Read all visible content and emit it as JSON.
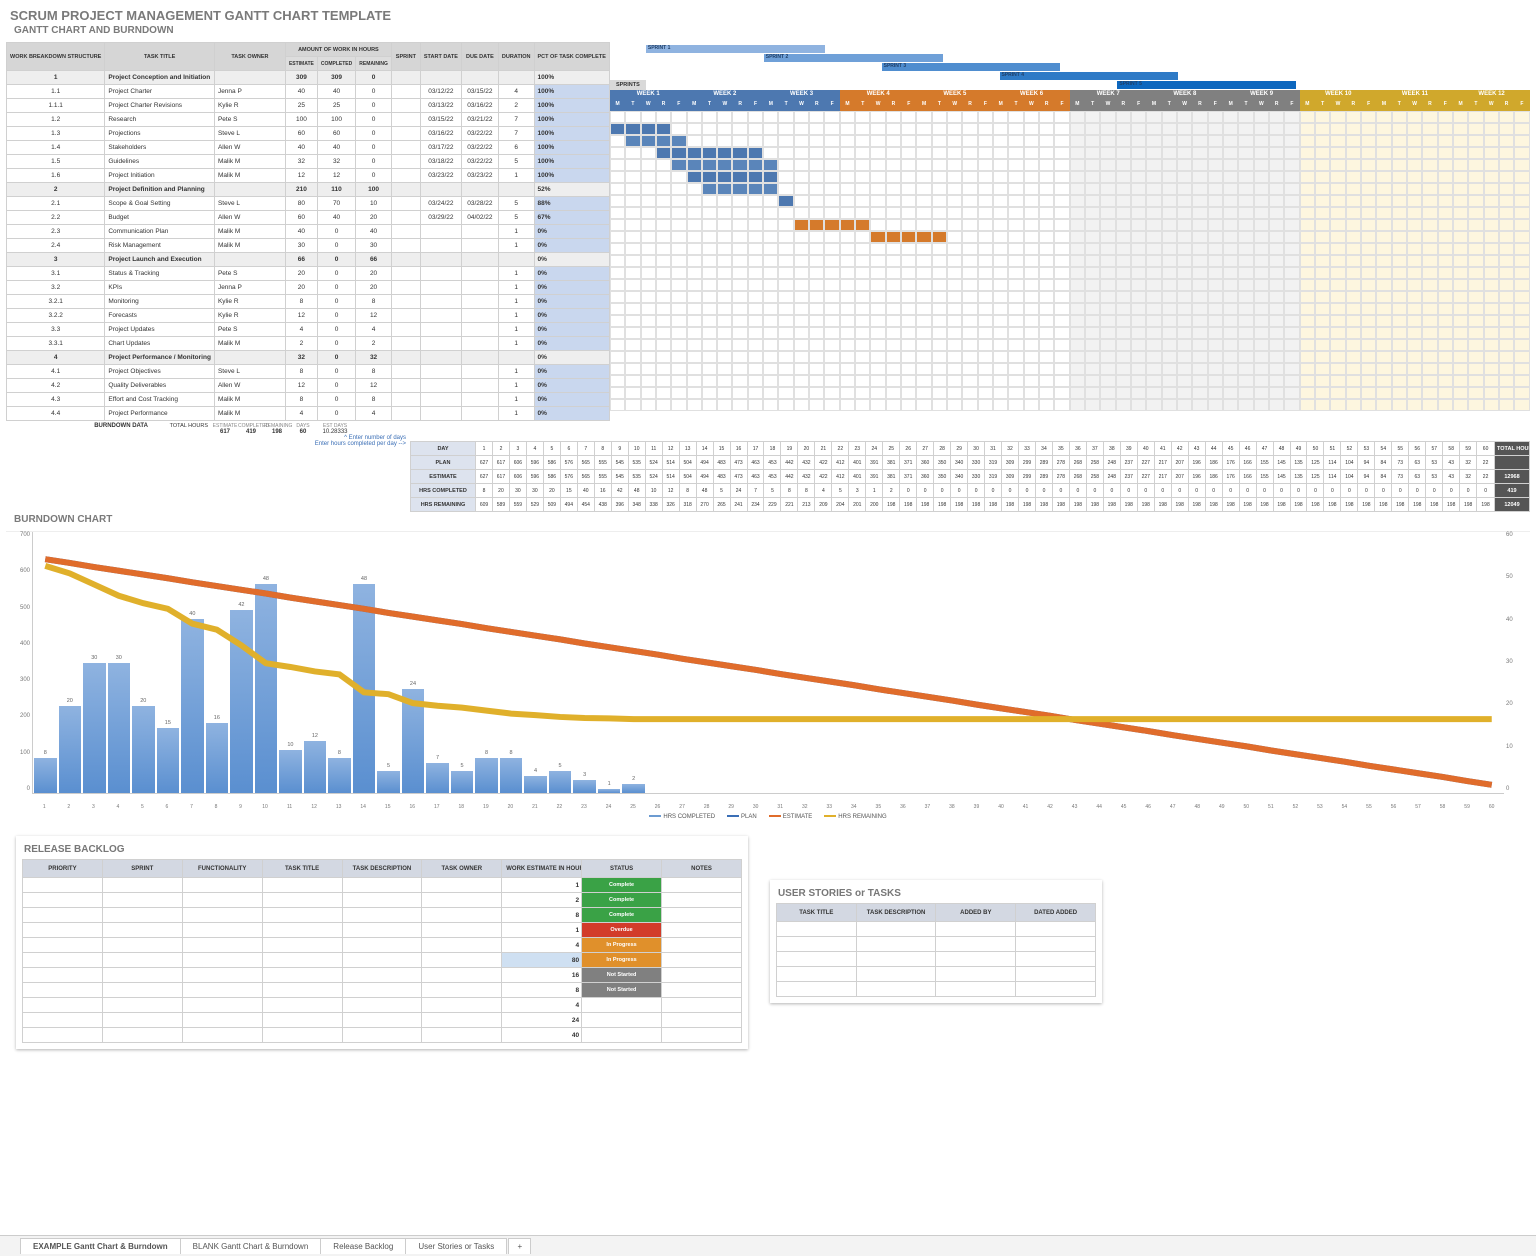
{
  "title": "SCRUM PROJECT MANAGEMENT GANTT CHART TEMPLATE",
  "subtitle": "GANTT CHART AND BURNDOWN",
  "burndown_chart_title": "BURNDOWN CHART",
  "burndown_data_title": "BURNDOWN DATA",
  "release_backlog_title": "RELEASE BACKLOG",
  "user_stories_title": "USER STORIES or TASKS",
  "task_headers": {
    "wbs": "WORK BREAKDOWN STRUCTURE",
    "title": "TASK TITLE",
    "owner": "TASK OWNER",
    "amount": "AMOUNT OF WORK IN HOURS",
    "est": "ESTIMATE",
    "comp": "COMPLETED",
    "rem": "REMAINING",
    "sprint": "SPRINT",
    "start": "START DATE",
    "due": "DUE DATE",
    "dur": "DURATION",
    "pct": "PCT OF TASK COMPLETE"
  },
  "sprints_label": "SPRINTS",
  "sprint_labels": [
    "SPRINT 1",
    "SPRINT 2",
    "SPRINT 3",
    "SPRINT 4",
    "SPRINT 5"
  ],
  "sprint_colors": [
    "#8fb3e0",
    "#6fa0d8",
    "#4f8dcf",
    "#2e7ac6",
    "#0d67be"
  ],
  "weeks": [
    {
      "label": "WEEK 1",
      "color": "#4d78b0"
    },
    {
      "label": "WEEK 2",
      "color": "#4d78b0"
    },
    {
      "label": "WEEK 3",
      "color": "#4d78b0"
    },
    {
      "label": "WEEK 4",
      "color": "#d57a2b"
    },
    {
      "label": "WEEK 5",
      "color": "#d57a2b"
    },
    {
      "label": "WEEK 6",
      "color": "#d57a2b"
    },
    {
      "label": "WEEK 7",
      "color": "#808080"
    },
    {
      "label": "WEEK 8",
      "color": "#808080"
    },
    {
      "label": "WEEK 9",
      "color": "#808080"
    },
    {
      "label": "WEEK 10",
      "color": "#d0a82c"
    },
    {
      "label": "WEEK 11",
      "color": "#d0a82c"
    },
    {
      "label": "WEEK 12",
      "color": "#d0a82c"
    }
  ],
  "days": [
    "M",
    "T",
    "W",
    "R",
    "F"
  ],
  "tasks": [
    {
      "wbs": "1",
      "title": "Project Conception and Initiation",
      "owner": "",
      "est": 309,
      "comp": 309,
      "rem": 0,
      "sprint": "",
      "start": "",
      "due": "",
      "dur": "",
      "pct": "100%",
      "sum": true
    },
    {
      "wbs": "1.1",
      "title": "Project Charter",
      "owner": "Jenna P",
      "est": 40,
      "comp": 40,
      "rem": 0,
      "sprint": "",
      "start": "03/12/22",
      "due": "03/15/22",
      "dur": 4,
      "pct": "100%",
      "bar": {
        "start": 0,
        "len": 4,
        "color": "#4d78b0"
      }
    },
    {
      "wbs": "1.1.1",
      "title": "Project Charter Revisions",
      "owner": "Kylie R",
      "est": 25,
      "comp": 25,
      "rem": 0,
      "sprint": "",
      "start": "03/13/22",
      "due": "03/16/22",
      "dur": 2,
      "pct": "100%",
      "bar": {
        "start": 1,
        "len": 4,
        "color": "#5a85ba"
      }
    },
    {
      "wbs": "1.2",
      "title": "Research",
      "owner": "Pete S",
      "est": 100,
      "comp": 100,
      "rem": 0,
      "sprint": "",
      "start": "03/15/22",
      "due": "03/21/22",
      "dur": 7,
      "pct": "100%",
      "bar": {
        "start": 3,
        "len": 7,
        "color": "#4d78b0"
      }
    },
    {
      "wbs": "1.3",
      "title": "Projections",
      "owner": "Steve L",
      "est": 60,
      "comp": 60,
      "rem": 0,
      "sprint": "",
      "start": "03/16/22",
      "due": "03/22/22",
      "dur": 7,
      "pct": "100%",
      "bar": {
        "start": 4,
        "len": 7,
        "color": "#5a85ba"
      }
    },
    {
      "wbs": "1.4",
      "title": "Stakeholders",
      "owner": "Allen W",
      "est": 40,
      "comp": 40,
      "rem": 0,
      "sprint": "",
      "start": "03/17/22",
      "due": "03/22/22",
      "dur": 6,
      "pct": "100%",
      "bar": {
        "start": 5,
        "len": 6,
        "color": "#4d78b0"
      }
    },
    {
      "wbs": "1.5",
      "title": "Guidelines",
      "owner": "Malik M",
      "est": 32,
      "comp": 32,
      "rem": 0,
      "sprint": "",
      "start": "03/18/22",
      "due": "03/22/22",
      "dur": 5,
      "pct": "100%",
      "bar": {
        "start": 6,
        "len": 5,
        "color": "#5a85ba"
      }
    },
    {
      "wbs": "1.6",
      "title": "Project Initiation",
      "owner": "Malik M",
      "est": 12,
      "comp": 12,
      "rem": 0,
      "sprint": "",
      "start": "03/23/22",
      "due": "03/23/22",
      "dur": 1,
      "pct": "100%",
      "bar": {
        "start": 11,
        "len": 1,
        "color": "#4d78b0"
      }
    },
    {
      "wbs": "2",
      "title": "Project Definition and Planning",
      "owner": "",
      "est": 210,
      "comp": 110,
      "rem": 100,
      "sprint": "",
      "start": "",
      "due": "",
      "dur": "",
      "pct": "52%",
      "sum": true
    },
    {
      "wbs": "2.1",
      "title": "Scope & Goal Setting",
      "owner": "Steve L",
      "est": 80,
      "comp": 70,
      "rem": 10,
      "sprint": "",
      "start": "03/24/22",
      "due": "03/28/22",
      "dur": 5,
      "pct": "88%",
      "bar": {
        "start": 12,
        "len": 5,
        "color": "#d57a2b"
      }
    },
    {
      "wbs": "2.2",
      "title": "Budget",
      "owner": "Allen W",
      "est": 60,
      "comp": 40,
      "rem": 20,
      "sprint": "",
      "start": "03/29/22",
      "due": "04/02/22",
      "dur": 5,
      "pct": "67%",
      "bar": {
        "start": 17,
        "len": 5,
        "color": "#d57a2b"
      }
    },
    {
      "wbs": "2.3",
      "title": "Communication Plan",
      "owner": "Malik M",
      "est": 40,
      "comp": 0,
      "rem": 40,
      "sprint": "",
      "start": "",
      "due": "",
      "dur": 1,
      "pct": "0%"
    },
    {
      "wbs": "2.4",
      "title": "Risk Management",
      "owner": "Malik M",
      "est": 30,
      "comp": 0,
      "rem": 30,
      "sprint": "",
      "start": "",
      "due": "",
      "dur": 1,
      "pct": "0%"
    },
    {
      "wbs": "3",
      "title": "Project Launch and Execution",
      "owner": "",
      "est": 66,
      "comp": 0,
      "rem": 66,
      "sprint": "",
      "start": "",
      "due": "",
      "dur": "",
      "pct": "0%",
      "sum": true
    },
    {
      "wbs": "3.1",
      "title": "Status & Tracking",
      "owner": "Pete S",
      "est": 20,
      "comp": 0,
      "rem": 20,
      "sprint": "",
      "start": "",
      "due": "",
      "dur": 1,
      "pct": "0%"
    },
    {
      "wbs": "3.2",
      "title": "KPIs",
      "owner": "Jenna P",
      "est": 20,
      "comp": 0,
      "rem": 20,
      "sprint": "",
      "start": "",
      "due": "",
      "dur": 1,
      "pct": "0%"
    },
    {
      "wbs": "3.2.1",
      "title": "Monitoring",
      "owner": "Kylie R",
      "est": 8,
      "comp": 0,
      "rem": 8,
      "sprint": "",
      "start": "",
      "due": "",
      "dur": 1,
      "pct": "0%"
    },
    {
      "wbs": "3.2.2",
      "title": "Forecasts",
      "owner": "Kylie R",
      "est": 12,
      "comp": 0,
      "rem": 12,
      "sprint": "",
      "start": "",
      "due": "",
      "dur": 1,
      "pct": "0%"
    },
    {
      "wbs": "3.3",
      "title": "Project Updates",
      "owner": "Pete S",
      "est": 4,
      "comp": 0,
      "rem": 4,
      "sprint": "",
      "start": "",
      "due": "",
      "dur": 1,
      "pct": "0%"
    },
    {
      "wbs": "3.3.1",
      "title": "Chart Updates",
      "owner": "Malik M",
      "est": 2,
      "comp": 0,
      "rem": 2,
      "sprint": "",
      "start": "",
      "due": "",
      "dur": 1,
      "pct": "0%"
    },
    {
      "wbs": "4",
      "title": "Project Performance / Monitoring",
      "owner": "",
      "est": 32,
      "comp": 0,
      "rem": 32,
      "sprint": "",
      "start": "",
      "due": "",
      "dur": "",
      "pct": "0%",
      "sum": true
    },
    {
      "wbs": "4.1",
      "title": "Project Objectives",
      "owner": "Steve L",
      "est": 8,
      "comp": 0,
      "rem": 8,
      "sprint": "",
      "start": "",
      "due": "",
      "dur": 1,
      "pct": "0%"
    },
    {
      "wbs": "4.2",
      "title": "Quality Deliverables",
      "owner": "Allen W",
      "est": 12,
      "comp": 0,
      "rem": 12,
      "sprint": "",
      "start": "",
      "due": "",
      "dur": 1,
      "pct": "0%"
    },
    {
      "wbs": "4.3",
      "title": "Effort and Cost Tracking",
      "owner": "Malik M",
      "est": 8,
      "comp": 0,
      "rem": 8,
      "sprint": "",
      "start": "",
      "due": "",
      "dur": 1,
      "pct": "0%"
    },
    {
      "wbs": "4.4",
      "title": "Project Performance",
      "owner": "Malik M",
      "est": 4,
      "comp": 0,
      "rem": 4,
      "sprint": "",
      "start": "",
      "due": "",
      "dur": 1,
      "pct": "0%"
    }
  ],
  "totals": {
    "hours_label": "TOTAL HOURS",
    "est_label": "ESTIMATE",
    "comp_label": "COMPLETED",
    "rem_label": "REMAINING",
    "days_label": "DAYS",
    "estdays_label": "EST DAYS",
    "est": 617,
    "comp": 419,
    "rem": 198,
    "days": 60,
    "estdays": "10.28333"
  },
  "notes": {
    "enter_days": "^ Enter number of days",
    "enter_completed": "Enter hours completed per day -->"
  },
  "burndown_rows": {
    "day": "DAY",
    "plan": "PLAN",
    "estimate": "ESTIMATE",
    "completed": "HRS COMPLETED",
    "remaining": "HRS REMAINING",
    "total": "TOTAL HOURS"
  },
  "burndown": {
    "days": 60,
    "plan": [
      627,
      617,
      606,
      596,
      586,
      576,
      565,
      555,
      545,
      535,
      524,
      514,
      504,
      494,
      483,
      473,
      463,
      453,
      442,
      432,
      422,
      412,
      401,
      391,
      381,
      371,
      360,
      350,
      340,
      330,
      319,
      309,
      299,
      289,
      278,
      268,
      258,
      248,
      237,
      227,
      217,
      207,
      196,
      186,
      176,
      166,
      155,
      145,
      135,
      125,
      114,
      104,
      94,
      84,
      73,
      63,
      53,
      43,
      32,
      22
    ],
    "estimate": [
      627,
      617,
      606,
      596,
      586,
      576,
      565,
      555,
      545,
      535,
      524,
      514,
      504,
      494,
      483,
      473,
      463,
      453,
      442,
      432,
      422,
      412,
      401,
      391,
      381,
      371,
      360,
      350,
      340,
      330,
      319,
      309,
      299,
      289,
      278,
      268,
      258,
      248,
      237,
      227,
      217,
      207,
      196,
      186,
      176,
      166,
      155,
      145,
      135,
      125,
      114,
      104,
      94,
      84,
      73,
      63,
      53,
      43,
      32,
      22
    ],
    "completed": [
      8,
      20,
      30,
      30,
      20,
      15,
      40,
      16,
      42,
      48,
      10,
      12,
      8,
      48,
      5,
      24,
      7,
      5,
      8,
      8,
      4,
      5,
      3,
      1,
      2,
      0,
      0,
      0,
      0,
      0,
      0,
      0,
      0,
      0,
      0,
      0,
      0,
      0,
      0,
      0,
      0,
      0,
      0,
      0,
      0,
      0,
      0,
      0,
      0,
      0,
      0,
      0,
      0,
      0,
      0,
      0,
      0,
      0,
      0,
      0
    ],
    "remaining": [
      609,
      589,
      559,
      529,
      509,
      494,
      454,
      438,
      396,
      348,
      338,
      326,
      318,
      270,
      265,
      241,
      234,
      229,
      221,
      213,
      209,
      204,
      201,
      200,
      198,
      198,
      198,
      198,
      198,
      198,
      198,
      198,
      198,
      198,
      198,
      198,
      198,
      198,
      198,
      198,
      198,
      198,
      198,
      198,
      198,
      198,
      198,
      198,
      198,
      198,
      198,
      198,
      198,
      198,
      198,
      198,
      198,
      198,
      198,
      198
    ],
    "total_estimate": 12968,
    "total_completed": 419,
    "total_remaining": 12049
  },
  "chart_data": {
    "type": "combo(bar+line)",
    "title": "BURNDOWN CHART",
    "x": [
      1,
      2,
      3,
      4,
      5,
      6,
      7,
      8,
      9,
      10,
      11,
      12,
      13,
      14,
      15,
      16,
      17,
      18,
      19,
      20,
      21,
      22,
      23,
      24,
      25,
      26,
      27,
      28,
      29,
      30,
      31,
      32,
      33,
      34,
      35,
      36,
      37,
      38,
      39,
      40,
      41,
      42,
      43,
      44,
      45,
      46,
      47,
      48,
      49,
      50,
      51,
      52,
      53,
      54,
      55,
      56,
      57,
      58,
      59,
      60
    ],
    "series": [
      {
        "name": "HRS COMPLETED",
        "kind": "bar",
        "axis": "right",
        "values": [
          8,
          20,
          30,
          30,
          20,
          15,
          40,
          16,
          42,
          48,
          10,
          12,
          8,
          48,
          5,
          24,
          7,
          5,
          8,
          8,
          4,
          5,
          3,
          1,
          2,
          0,
          0,
          0,
          0,
          0,
          0,
          0,
          0,
          0,
          0,
          0,
          0,
          0,
          0,
          0,
          0,
          0,
          0,
          0,
          0,
          0,
          0,
          0,
          0,
          0,
          0,
          0,
          0,
          0,
          0,
          0,
          0,
          0,
          0,
          0
        ]
      },
      {
        "name": "PLAN",
        "kind": "line",
        "axis": "left",
        "values": [
          627,
          617,
          606,
          596,
          586,
          576,
          565,
          555,
          545,
          535,
          524,
          514,
          504,
          494,
          483,
          473,
          463,
          453,
          442,
          432,
          422,
          412,
          401,
          391,
          381,
          371,
          360,
          350,
          340,
          330,
          319,
          309,
          299,
          289,
          278,
          268,
          258,
          248,
          237,
          227,
          217,
          207,
          196,
          186,
          176,
          166,
          155,
          145,
          135,
          125,
          114,
          104,
          94,
          84,
          73,
          63,
          53,
          43,
          32,
          22
        ]
      },
      {
        "name": "ESTIMATE",
        "kind": "line",
        "axis": "left",
        "values": [
          627,
          617,
          606,
          596,
          586,
          576,
          565,
          555,
          545,
          535,
          524,
          514,
          504,
          494,
          483,
          473,
          463,
          453,
          442,
          432,
          422,
          412,
          401,
          391,
          381,
          371,
          360,
          350,
          340,
          330,
          319,
          309,
          299,
          289,
          278,
          268,
          258,
          248,
          237,
          227,
          217,
          207,
          196,
          186,
          176,
          166,
          155,
          145,
          135,
          125,
          114,
          104,
          94,
          84,
          73,
          63,
          53,
          43,
          32,
          22
        ]
      },
      {
        "name": "HRS REMAINING",
        "kind": "line",
        "axis": "left",
        "values": [
          609,
          589,
          559,
          529,
          509,
          494,
          454,
          438,
          396,
          348,
          338,
          326,
          318,
          270,
          265,
          241,
          234,
          229,
          221,
          213,
          209,
          204,
          201,
          200,
          198,
          198,
          198,
          198,
          198,
          198,
          198,
          198,
          198,
          198,
          198,
          198,
          198,
          198,
          198,
          198,
          198,
          198,
          198,
          198,
          198,
          198,
          198,
          198,
          198,
          198,
          198,
          198,
          198,
          198,
          198,
          198,
          198,
          198,
          198,
          198
        ]
      }
    ],
    "ylim_left": [
      0,
      700
    ],
    "yticks_left": [
      0,
      100,
      200,
      300,
      400,
      500,
      600,
      700
    ],
    "ylim_right": [
      0,
      60
    ],
    "yticks_right": [
      0,
      10,
      20,
      30,
      40,
      50,
      60
    ],
    "colors": {
      "HRS COMPLETED": "#6c9bd1",
      "PLAN": "#3b6fb6",
      "ESTIMATE": "#e06c2b",
      "HRS REMAINING": "#e0b02b"
    }
  },
  "backlog_headers": [
    "PRIORITY",
    "SPRINT",
    "FUNCTIONALITY",
    "TASK TITLE",
    "TASK DESCRIPTION",
    "TASK OWNER",
    "WORK ESTIMATE IN HOURS",
    "STATUS",
    "NOTES"
  ],
  "backlog_rows": [
    {
      "hours": 1,
      "status": "Complete",
      "status_color": "#3aa246"
    },
    {
      "hours": 2,
      "status": "Complete",
      "status_color": "#3aa246"
    },
    {
      "hours": 8,
      "status": "Complete",
      "status_color": "#3aa246"
    },
    {
      "hours": 1,
      "status": "Overdue",
      "status_color": "#d23c2a"
    },
    {
      "hours": 4,
      "status": "In Progress",
      "status_color": "#e0902b"
    },
    {
      "hours": 80,
      "status": "In Progress",
      "status_color": "#e0902b",
      "highlight": true
    },
    {
      "hours": 16,
      "status": "Not Started",
      "status_color": "#808080"
    },
    {
      "hours": 8,
      "status": "Not Started",
      "status_color": "#808080"
    },
    {
      "hours": 4,
      "status": ""
    },
    {
      "hours": 24,
      "status": ""
    },
    {
      "hours": 40,
      "status": ""
    }
  ],
  "stories_headers": [
    "TASK TITLE",
    "TASK DESCRIPTION",
    "ADDED BY",
    "DATED ADDED"
  ],
  "tabs": [
    "EXAMPLE Gantt Chart & Burndown",
    "BLANK Gantt Chart & Burndown",
    "Release Backlog",
    "User Stories or Tasks"
  ],
  "active_tab": 0
}
